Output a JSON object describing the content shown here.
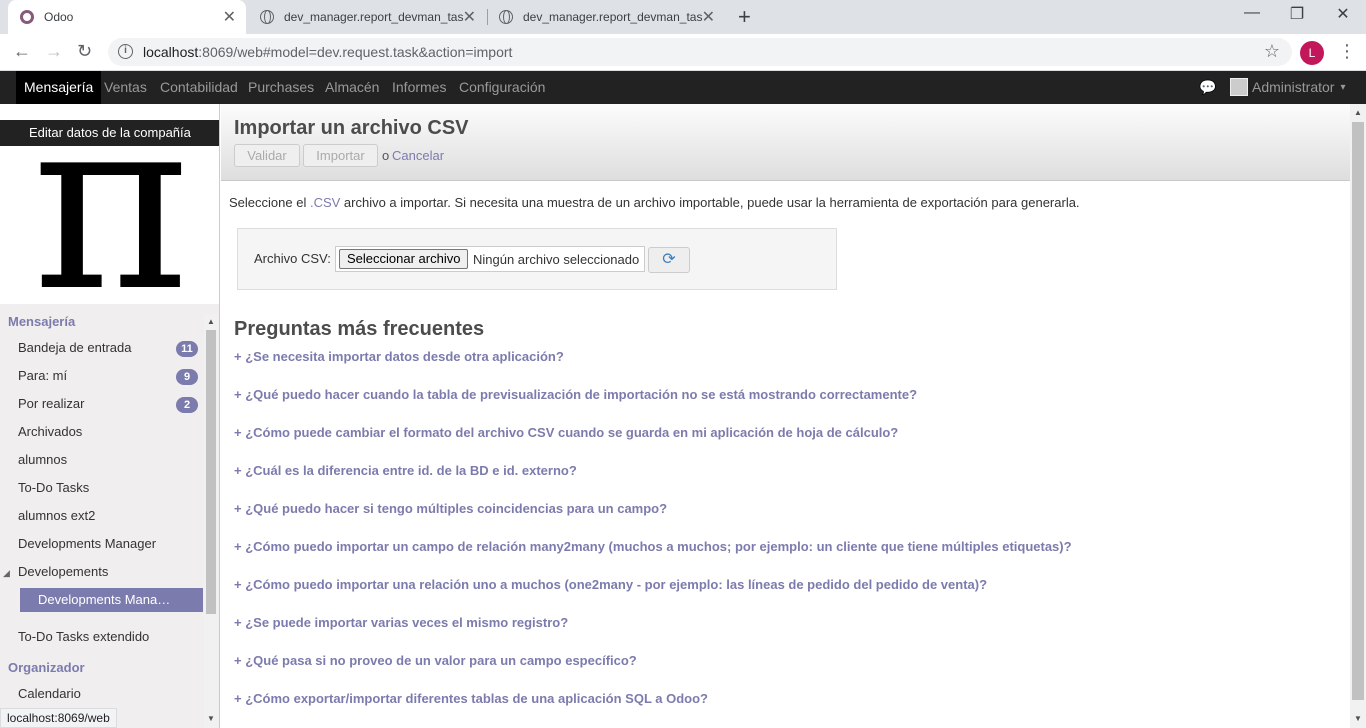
{
  "browser": {
    "tabs": [
      {
        "title": "Odoo",
        "icon": "odoo-icon",
        "active": true
      },
      {
        "title": "dev_manager.report_devman_tas",
        "icon": "globe-icon",
        "active": false
      },
      {
        "title": "dev_manager.report_devman_tas",
        "icon": "globe-icon",
        "active": false
      }
    ],
    "close_glyph": "✕",
    "new_tab_glyph": "+",
    "window_controls": {
      "minimize": "—",
      "maximize": "❐",
      "close": "✕"
    },
    "nav": {
      "back": "←",
      "forward": "→",
      "reload": "↻"
    },
    "url_host": "localhost",
    "url_rest": ":8069/web#model=dev.request.task&action=import",
    "star_glyph": "☆",
    "profile_initial": "L",
    "menu_glyph": "⋮",
    "status_url": "localhost:8069/web"
  },
  "topmenu": {
    "items": [
      "Mensajería",
      "Ventas",
      "Contabilidad",
      "Purchases",
      "Almacén",
      "Informes",
      "Configuración"
    ],
    "chat_glyph": "💬",
    "user": "Administrator",
    "caret": "▾"
  },
  "sidebar": {
    "company_edit": "Editar datos de la compañía",
    "logo_glyph": "π",
    "sections": {
      "mensajeria": "Mensajería",
      "organizador": "Organizador"
    },
    "items": [
      {
        "label": "Bandeja de entrada",
        "badge": "11"
      },
      {
        "label": "Para: mí",
        "badge": "9"
      },
      {
        "label": "Por realizar",
        "badge": "2"
      },
      {
        "label": "Archivados"
      },
      {
        "label": "alumnos"
      },
      {
        "label": "To-Do Tasks"
      },
      {
        "label": "alumnos ext2"
      },
      {
        "label": "Developments Manager"
      },
      {
        "label": "Developements"
      },
      {
        "label": "Developments Mana…"
      },
      {
        "label": "To-Do Tasks extendido"
      },
      {
        "label": "Calendario"
      }
    ],
    "expander_glyph": "◢"
  },
  "control_panel": {
    "title": "Importar un archivo CSV",
    "validate": "Validar",
    "import": "Importar",
    "or": "o",
    "cancel": "Cancelar"
  },
  "intro": {
    "before": "Seleccione el ",
    "link": ".CSV",
    "after": " archivo a importar. Si necesita una muestra de un archivo importable, puede usar la herramienta de exportación para generarla."
  },
  "file": {
    "label": "Archivo CSV:",
    "button": "Seleccionar archivo",
    "none": "Ningún archivo seleccionado",
    "reload_glyph": "⟳"
  },
  "faq": {
    "title": "Preguntas más frecuentes",
    "items": [
      "+ ¿Se necesita importar datos desde otra aplicación?",
      "+ ¿Qué puedo hacer cuando la tabla de previsualización de importación no se está mostrando correctamente?",
      "+ ¿Cómo puede cambiar el formato del archivo CSV cuando se guarda en mi aplicación de hoja de cálculo?",
      "+ ¿Cuál es la diferencia entre id. de la BD e id. externo?",
      "+ ¿Qué puedo hacer si tengo múltiples coincidencias para un campo?",
      "+ ¿Cómo puedo importar un campo de relación many2many (muchos a muchos; por ejemplo: un cliente que tiene múltiples etiquetas)?",
      "+ ¿Cómo puedo importar una relación uno a muchos (one2many - por ejemplo: las líneas de pedido del pedido de venta)?",
      "+ ¿Se puede importar varias veces el mismo registro?",
      "+ ¿Qué pasa si no proveo de un valor para un campo específico?",
      "+ ¿Cómo exportar/importar diferentes tablas de una aplicación SQL a Odoo?"
    ]
  },
  "scroll": {
    "up": "▲",
    "down": "▼"
  },
  "colors": {
    "accent": "#7c7bad",
    "topbar": "#222222",
    "profile": "#c2185b"
  }
}
